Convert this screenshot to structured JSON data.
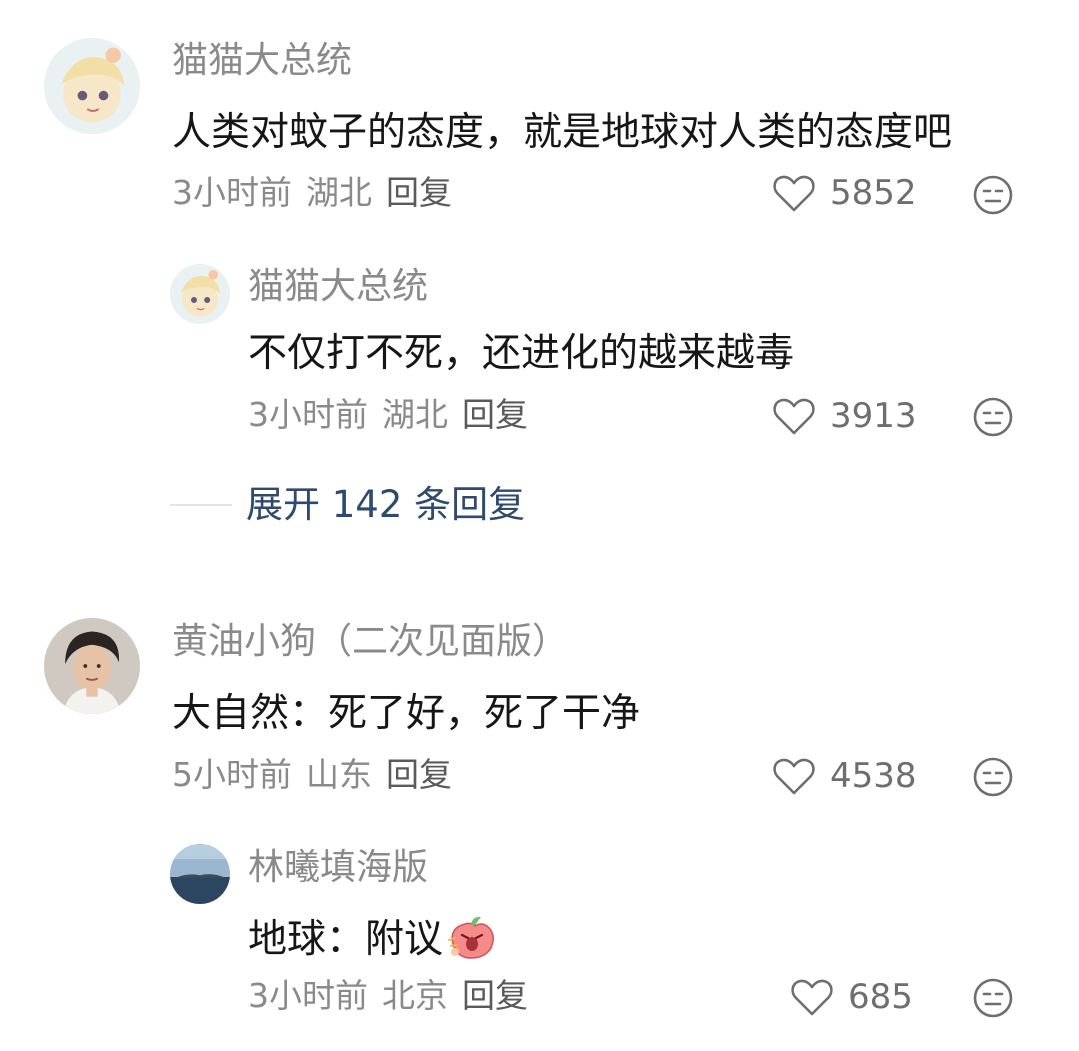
{
  "comments": [
    {
      "username": "猫猫大总统",
      "content": "人类对蚊子的态度，就是地球对人类的态度吧",
      "time": "3小时前",
      "location": "湖北",
      "reply_label": "回复",
      "likes": "5852"
    },
    {
      "username": "猫猫大总统",
      "content": "不仅打不死，还进化的越来越毒",
      "time": "3小时前",
      "location": "湖北",
      "reply_label": "回复",
      "likes": "3913"
    },
    {
      "username": "黄油小狗（二次见面版）",
      "content": "大自然：死了好，死了干净",
      "time": "5小时前",
      "location": "山东",
      "reply_label": "回复",
      "likes": "4538"
    },
    {
      "username": "林曦填海版",
      "content": "地球：附议",
      "time": "3小时前",
      "location": "北京",
      "reply_label": "回复",
      "likes": "685"
    }
  ],
  "expand_replies": "展开 142 条回复",
  "icons": {
    "like": "heart-outline-icon",
    "dislike": "unamused-face-icon",
    "emoji": "angry-peach-emoji"
  },
  "colors": {
    "username": "#8a8a8a",
    "link": "#2e4a6e",
    "text": "#161616"
  }
}
